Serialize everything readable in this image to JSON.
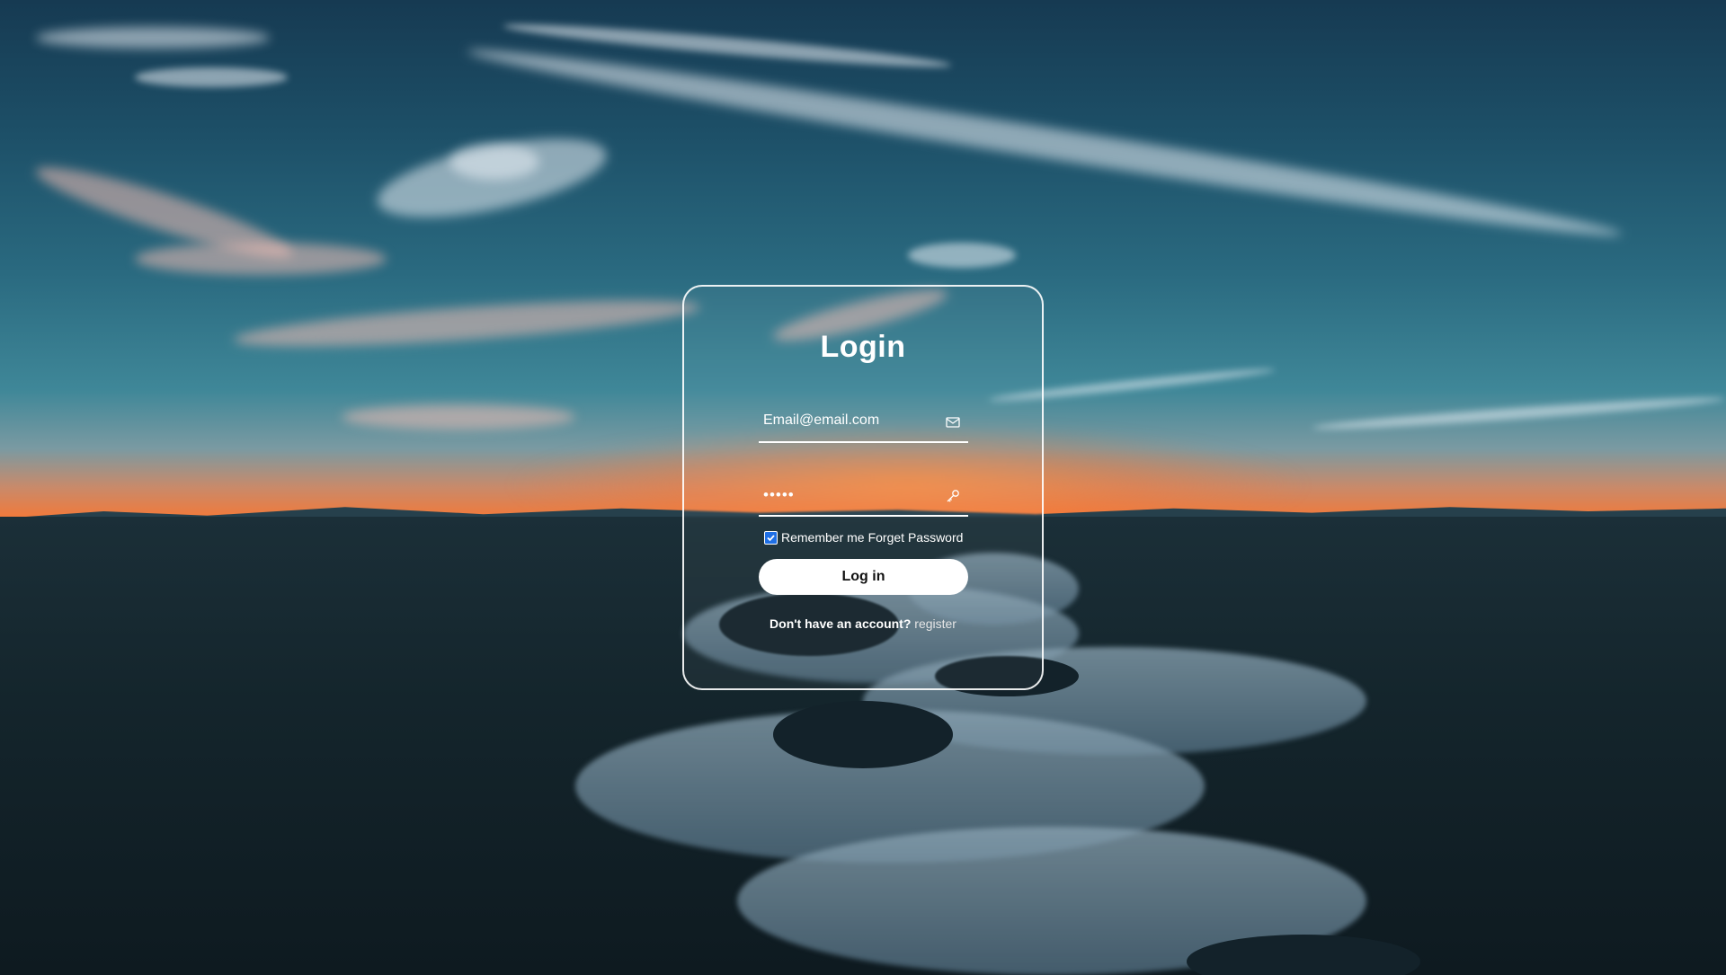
{
  "login": {
    "title": "Login",
    "email": {
      "value": "Email@email.com",
      "icon": "mail-icon"
    },
    "password": {
      "value": "•••••",
      "icon": "key-icon"
    },
    "remember_label": "Remember me",
    "remember_checked": true,
    "forgot_label": "Forget Password",
    "submit_label": "Log in",
    "register_prompt": "Don't have an account?",
    "register_link": "register"
  },
  "colors": {
    "card_border": "#ffffff",
    "button_bg": "#ffffff",
    "checkbox_accent": "#1f6fe5"
  }
}
